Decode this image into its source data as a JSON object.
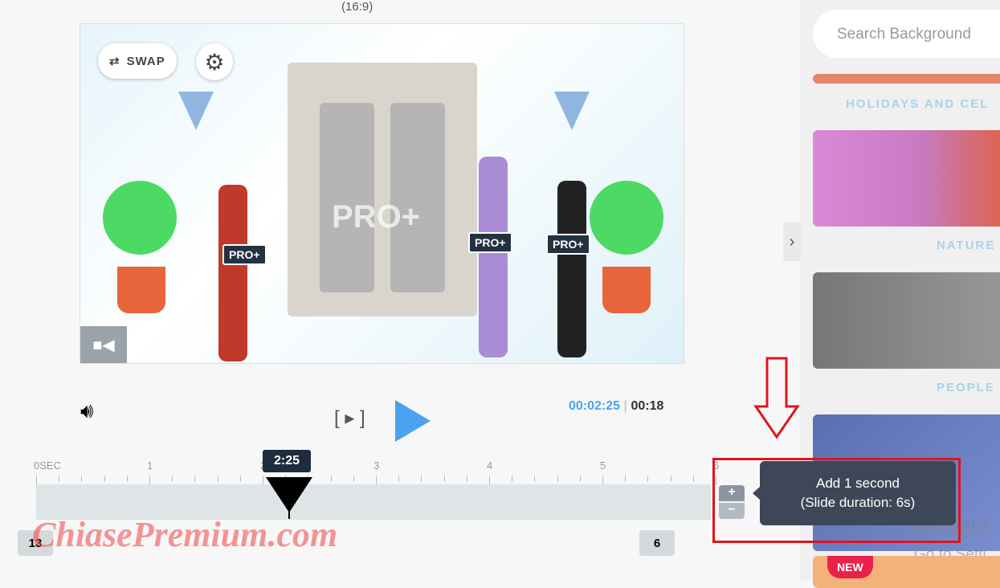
{
  "stage": {
    "aspect": "(16:9)",
    "swap_label": "SWAP",
    "watermark": "PRO+",
    "badges": [
      "PRO+",
      "PRO+",
      "PRO+"
    ]
  },
  "player": {
    "current_time": "00:02:25",
    "separator": "|",
    "total_time": "00:18"
  },
  "timeline": {
    "ticks": [
      "0SEC",
      "1",
      "2",
      "3",
      "4",
      "5",
      "6"
    ],
    "playhead_label": "2:25",
    "slide_left_count": "13",
    "slide_right_count": "6",
    "plus": "+",
    "minus": "−"
  },
  "tooltip": {
    "line1": "Add 1 second",
    "line2": "(Slide duration: 6s)"
  },
  "sidebar": {
    "search_placeholder": "Search Background",
    "categories": [
      "HOLIDAYS AND CEL",
      "NATURE",
      "PEOPLE"
    ],
    "new_badge": "NEW"
  },
  "overlay": {
    "activate_line1": "Activate",
    "activate_line2": "Go to Setti",
    "site_watermark": "ChiasePremium.com"
  },
  "colors": {
    "accent": "#4aa3f0",
    "tooltip": "#3d4757",
    "highlight": "#e0141c"
  }
}
